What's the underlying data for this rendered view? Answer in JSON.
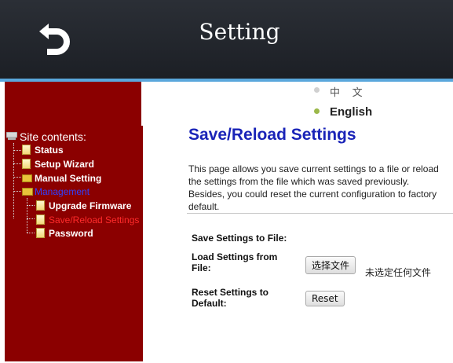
{
  "header": {
    "title": "Setting",
    "back_icon": "back-arrow-icon"
  },
  "language": {
    "chinese": "中 文",
    "english": "English",
    "selected": "English"
  },
  "sidebar": {
    "root": "Site contents:",
    "items": [
      {
        "label": "Status"
      },
      {
        "label": "Setup Wizard"
      },
      {
        "label": "Manual Setting"
      },
      {
        "label": "Management"
      },
      {
        "label": "Upgrade Firmware"
      },
      {
        "label": "Save/Reload Settings"
      },
      {
        "label": "Password"
      }
    ]
  },
  "main": {
    "title": "Save/Reload Settings",
    "description": "This page allows you save current settings to a file or reload the settings from the file which was saved previously. Besides, you could reset the current configuration to factory default.",
    "save_label": "Save Settings to File:",
    "load_label": "Load Settings from File:",
    "file_button": "选择文件",
    "no_file_text": "未选定任何文件",
    "reset_label": "Reset Settings to Default:",
    "reset_button": "Reset"
  },
  "colors": {
    "header_bg": "#22262c",
    "sidebar_bg": "#8b0000",
    "title_blue": "#1a24b8",
    "selected_red": "#ff2a2a",
    "management_blue": "#3040ff"
  }
}
